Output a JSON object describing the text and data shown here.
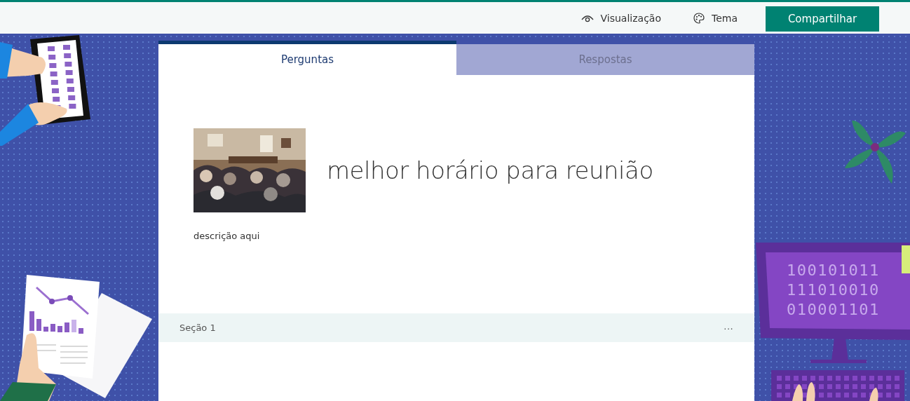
{
  "topbar": {
    "actions": [
      {
        "kind": "preview",
        "label": "Visualização"
      },
      {
        "kind": "theme",
        "label": "Tema"
      }
    ],
    "share_button": "Compartilhar"
  },
  "tabs": [
    {
      "label": "Perguntas",
      "selected": true
    },
    {
      "label": "Respostas",
      "selected": false
    }
  ],
  "form": {
    "title": "melhor horário para reunião",
    "description": "descrição aqui"
  },
  "sections": [
    {
      "label": "Seção 1",
      "menu": "···"
    }
  ],
  "background": {
    "monitor_lines": [
      "100101011",
      "111010010",
      "010001101"
    ]
  }
}
